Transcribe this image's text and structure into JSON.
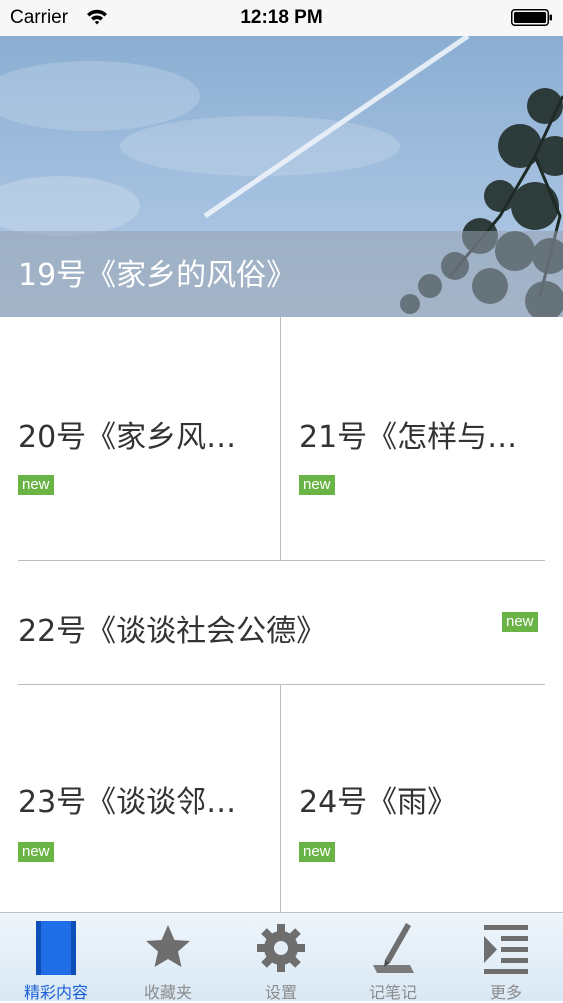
{
  "status_bar": {
    "carrier": "Carrier",
    "time": "12:18 PM"
  },
  "hero": {
    "title": "19号《家乡的风俗》"
  },
  "articles": [
    {
      "title": "20号《家乡风…",
      "badge": "new"
    },
    {
      "title": "21号《怎样与…",
      "badge": "new"
    },
    {
      "title": "22号《谈谈社会公德》",
      "badge": "new"
    },
    {
      "title": "23号《谈谈邻…",
      "badge": "new"
    },
    {
      "title": "24号《雨》",
      "badge": "new"
    }
  ],
  "tabbar": {
    "tabs": [
      {
        "label": "精彩内容",
        "icon": "book-icon",
        "active": true
      },
      {
        "label": "收藏夹",
        "icon": "star-icon",
        "active": false
      },
      {
        "label": "设置",
        "icon": "gear-icon",
        "active": false
      },
      {
        "label": "记笔记",
        "icon": "pen-icon",
        "active": false
      },
      {
        "label": "更多",
        "icon": "more-icon",
        "active": false
      }
    ]
  },
  "colors": {
    "badge": "#6ab445",
    "active_tab": "#1a5fd6",
    "inactive_tab": "#8c8c8c"
  }
}
